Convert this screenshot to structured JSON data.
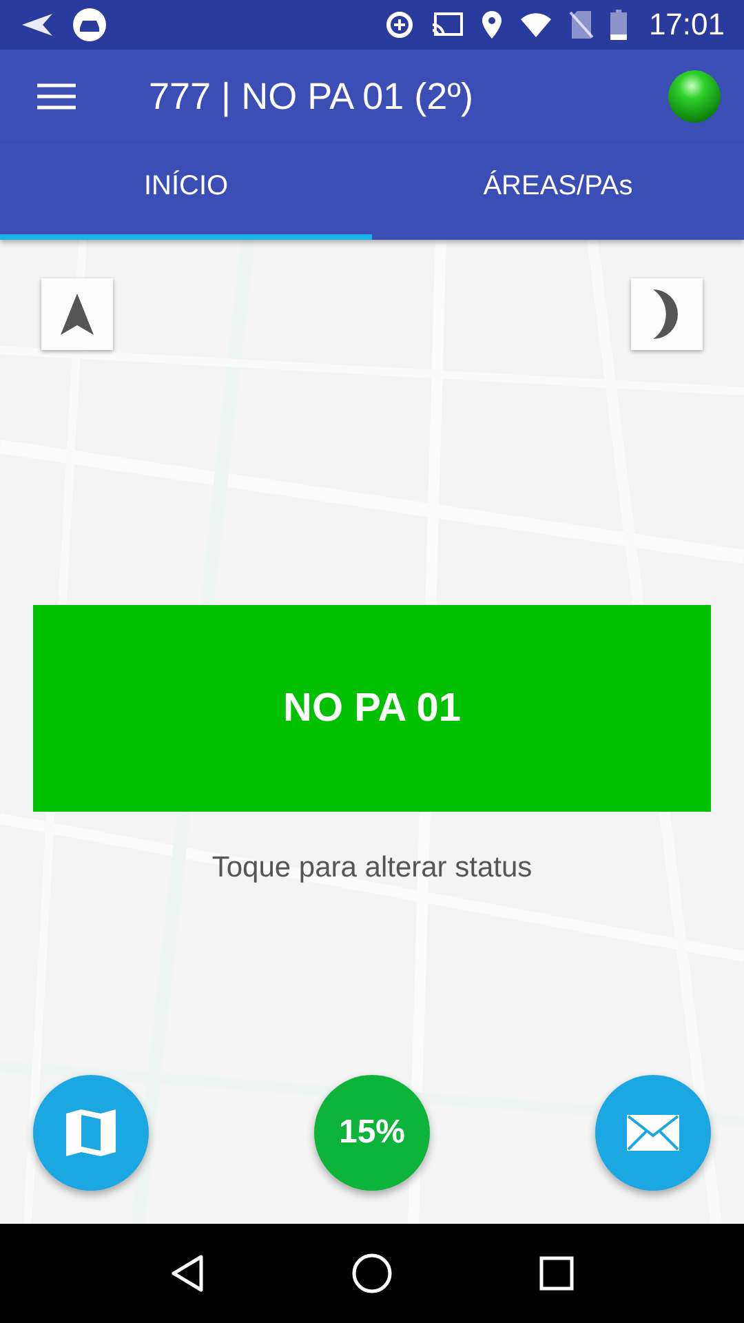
{
  "status_bar": {
    "time": "17:01"
  },
  "app_bar": {
    "title": "777 | NO PA 01 (2º)"
  },
  "tabs": [
    {
      "label": "INÍCIO",
      "selected": true
    },
    {
      "label": "ÁREAS/PAs",
      "selected": false
    }
  ],
  "status_button": {
    "label": "NO PA 01"
  },
  "hint": "Toque para alterar status",
  "progress_button": {
    "label": "15%"
  }
}
